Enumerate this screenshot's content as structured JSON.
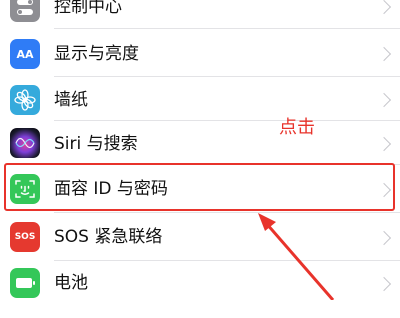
{
  "rows": [
    {
      "label": "控制中心",
      "icon": "control-center-icon"
    },
    {
      "label": "显示与亮度",
      "icon": "display-brightness-icon",
      "icon_text": "AA"
    },
    {
      "label": "墙纸",
      "icon": "wallpaper-icon"
    },
    {
      "label": "Siri 与搜索",
      "icon": "siri-icon"
    },
    {
      "label": "面容 ID 与密码",
      "icon": "face-id-icon"
    },
    {
      "label": "SOS 紧急联络",
      "icon": "sos-icon",
      "icon_text": "SOS"
    },
    {
      "label": "电池",
      "icon": "battery-icon"
    }
  ],
  "annotation": {
    "text": "点击",
    "color": "#e8332b"
  },
  "colors": {
    "control_center": "#8e8e93",
    "display": "#2f7cf6",
    "wallpaper": "#35aadc",
    "face_id": "#34c759",
    "sos": "#e5392f",
    "battery": "#34c759",
    "highlight": "#e8332b"
  }
}
